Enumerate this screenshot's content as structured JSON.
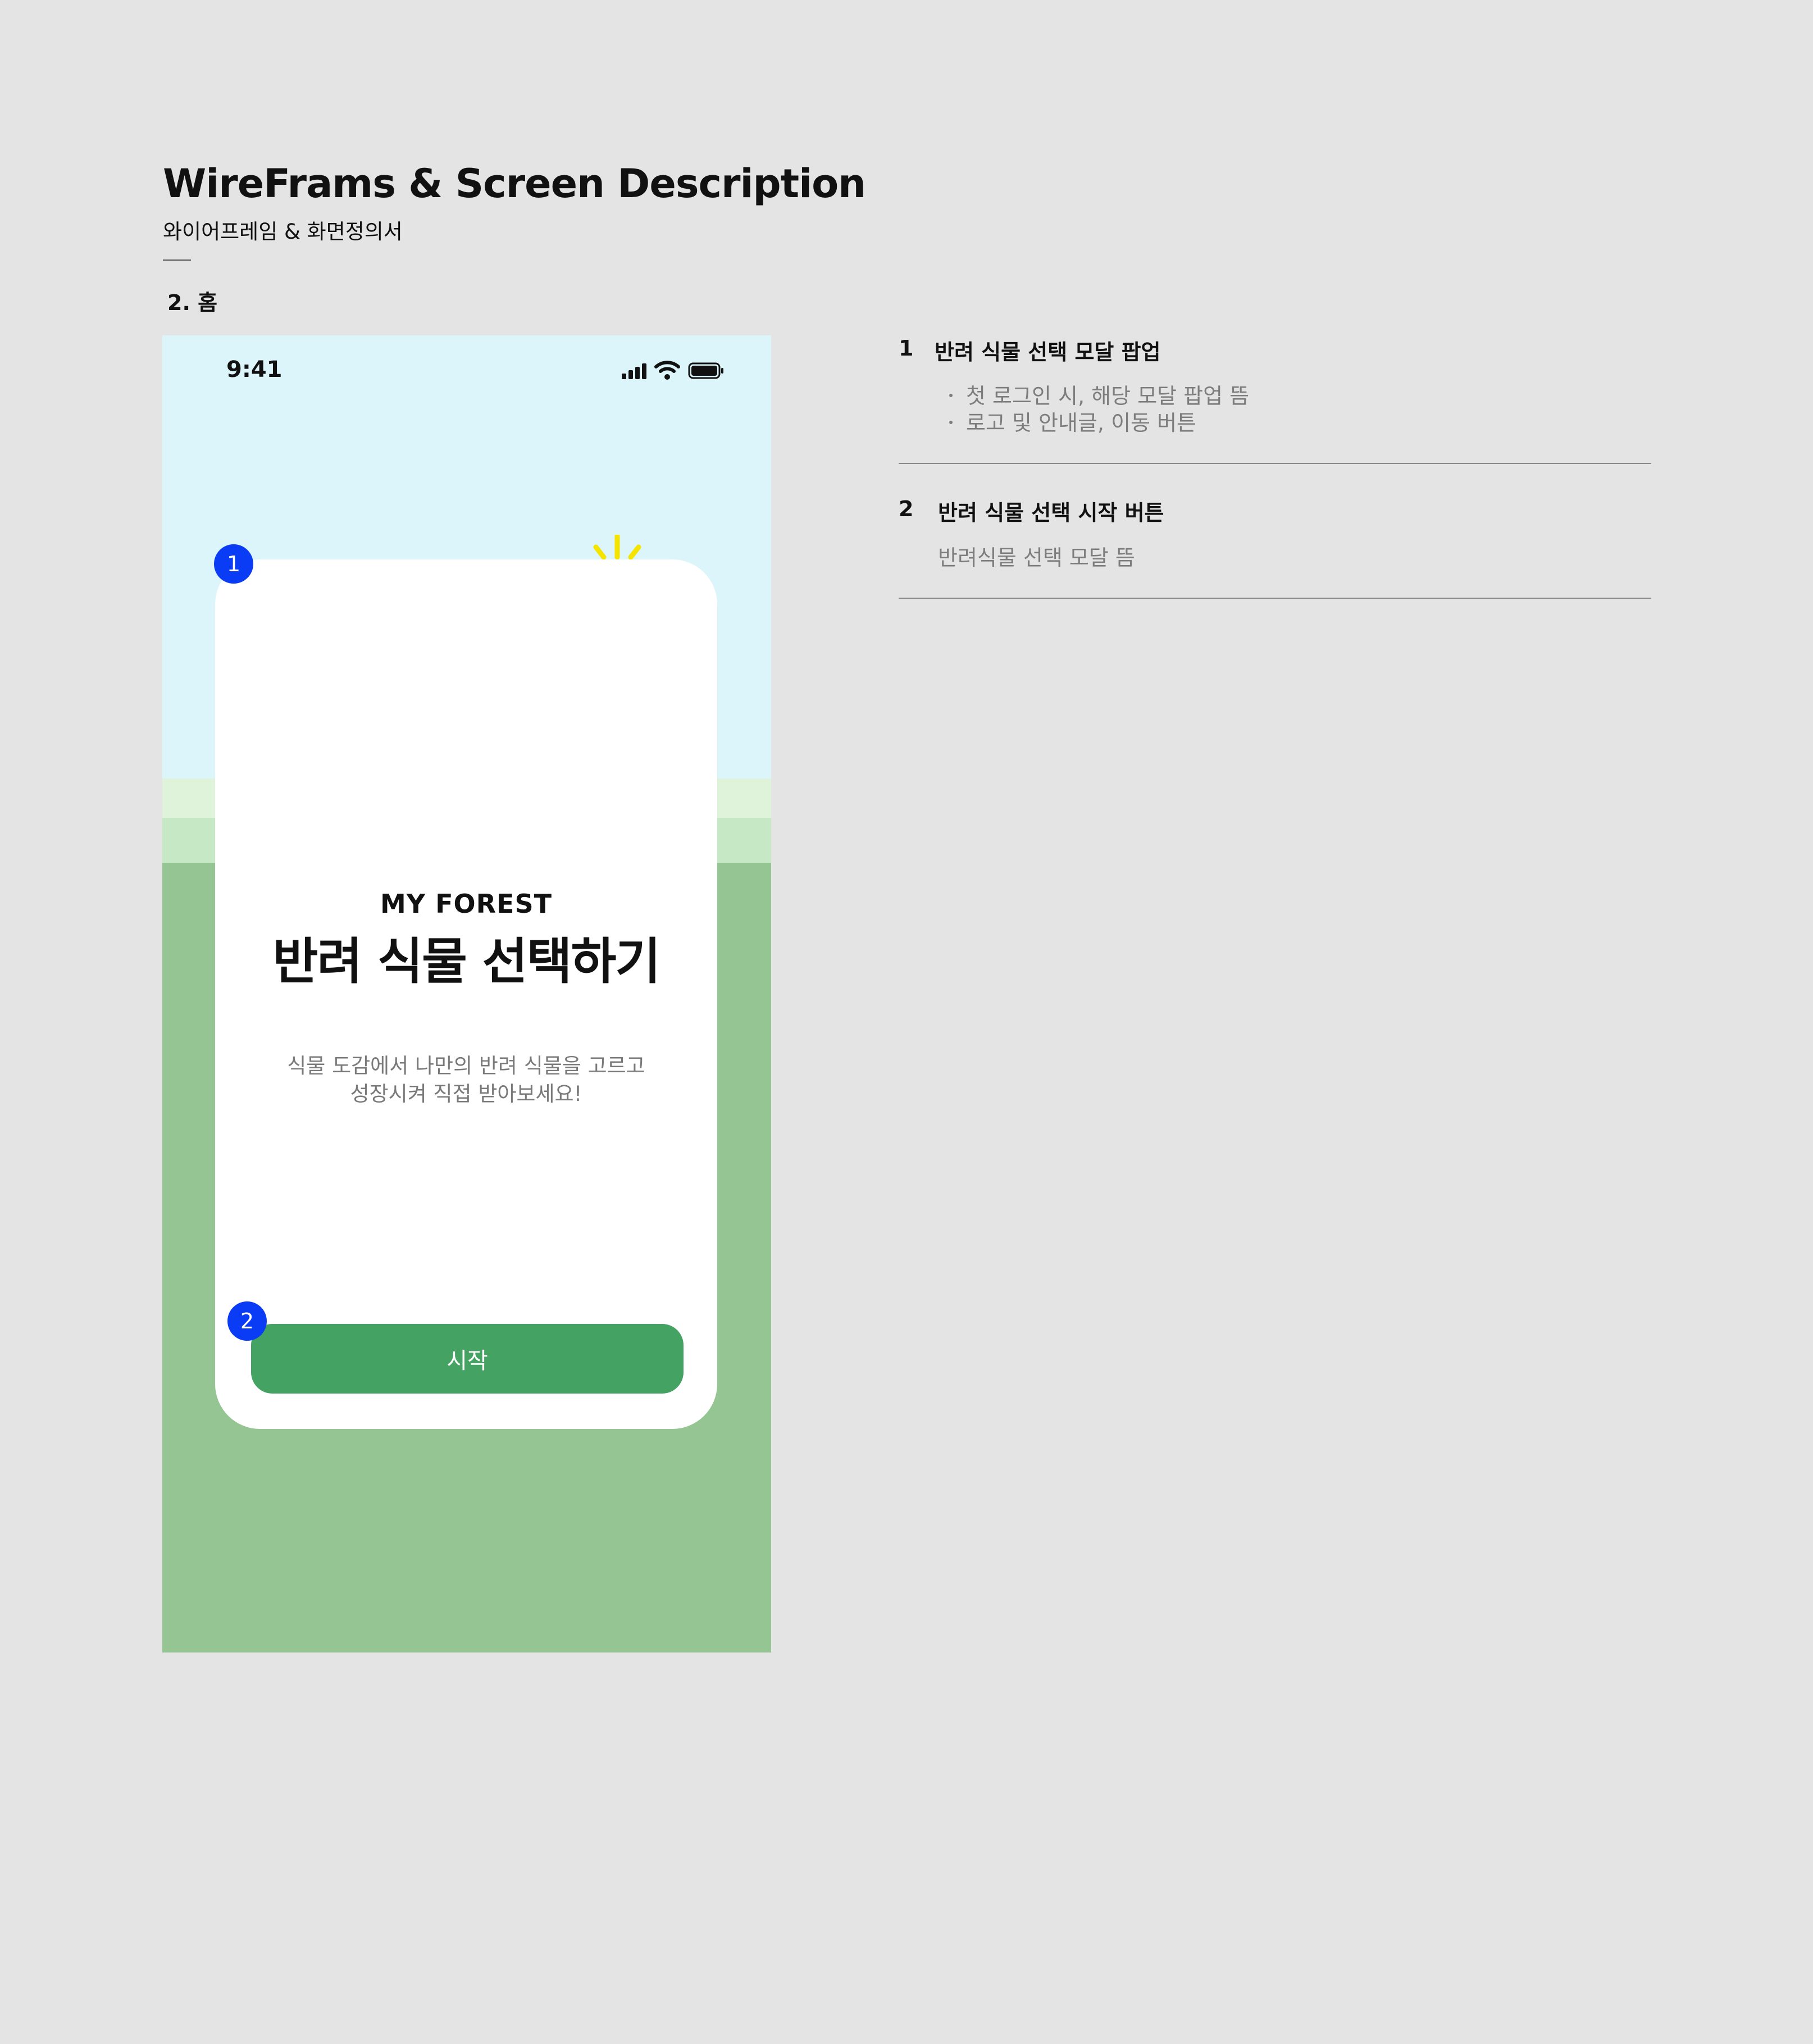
{
  "document": {
    "title": "WireFrams & Screen Description",
    "subtitle": "와이어프레임 & 화면정의서",
    "section_label": "2. 홈"
  },
  "phone": {
    "status_time": "9:41",
    "icons": [
      "signal-icon",
      "wifi-icon",
      "battery-icon",
      "sun-icon"
    ],
    "modal": {
      "logo": "MY FOREST",
      "title": "반려 식물 선택하기",
      "description_line1": "식물 도감에서 나만의 반려 식물을 고르고",
      "description_line2": "성장시켜 직접 받아보세요!",
      "start_label": "시작"
    },
    "badges": [
      "1",
      "2"
    ]
  },
  "descriptions": [
    {
      "number": "1",
      "heading": "반려 식물 선택 모달 팝업",
      "lines": [
        "첫 로그인 시, 해당 모달 팝업 뜸",
        "로고 및 안내글, 이동 버튼"
      ]
    },
    {
      "number": "2",
      "heading": "반려 식물 선택 시작 버튼",
      "lines": [
        "반려식물 선택 모달 뜸"
      ]
    }
  ],
  "colors": {
    "background": "#e4e4e4",
    "sky": "#dcf5fb",
    "grass": "#96c594",
    "button": "#44a262",
    "badge": "#0a3cf5",
    "sun": "#f5e400"
  }
}
